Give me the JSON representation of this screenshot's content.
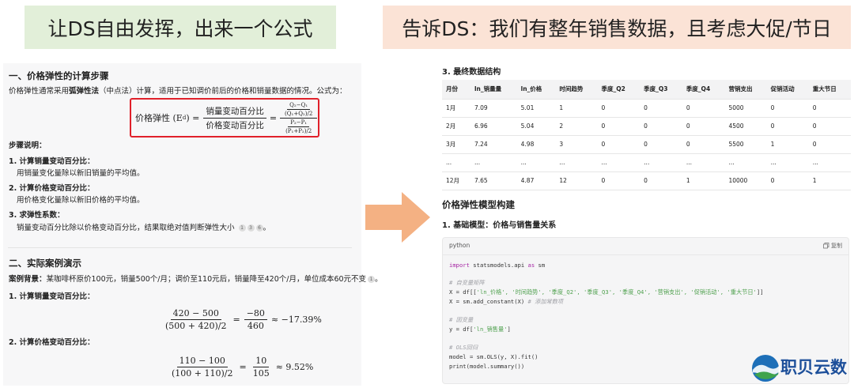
{
  "banners": {
    "left": "让DS自由发挥，出来一个公式",
    "right": "告诉DS：我们有整年销售数据，且考虑大促/节日"
  },
  "left_panel": {
    "section1_title": "一、价格弹性的计算步骤",
    "intro_pre": "价格弹性通常采用",
    "intro_bold": "弧弹性法",
    "intro_post": "（中点法）计算，适用于已知调价前后的价格和销量数据的情况。公式为：",
    "formula": {
      "lhs": "价格弹性 (E",
      "lhs_sub": "d",
      "lhs_end": ") =",
      "num_text": "销量变动百分比",
      "den_text": "价格变动百分比",
      "eq": "=",
      "num_expr_top": "Q₂−Q₁",
      "num_expr_bot": "(Q₁+Q₂)/2",
      "den_expr_top": "P₂−P₁",
      "den_expr_bot": "(P₁+P₂)/2"
    },
    "steps_title": "步骤说明：",
    "steps": [
      {
        "title": "1. 计算销量变动百分比：",
        "desc": "用销量变化量除以新旧销量的平均值。"
      },
      {
        "title": "2. 计算价格变动百分比：",
        "desc": "用价格变化量除以新旧价格的平均值。"
      },
      {
        "title": "3. 求弹性系数：",
        "desc": "销量变动百分比除以价格变动百分比，结果取绝对值判断弹性大小"
      }
    ],
    "step3_cites": [
      "1",
      "3",
      "6"
    ],
    "section2_title": "二、实际案例演示",
    "case_label": "案例背景：",
    "case_text": "某咖啡杯原价100元，销量500个/月；调价至110元后，销量降至420个/月，单位成本60元不变",
    "case_cite": "1",
    "calc1_title": "1. 计算销量变动百分比：",
    "calc1": {
      "n1": "420 − 500",
      "d1": "(500 + 420)/2",
      "n2": "−80",
      "d2": "460",
      "result": "≈ −17.39%"
    },
    "calc2_title": "2. 计算价格变动百分比：",
    "calc2": {
      "n1": "110 − 100",
      "d1": "(100 + 110)/2",
      "n2": "10",
      "d2": "105",
      "result": "≈ 9.52%"
    }
  },
  "right_panel": {
    "section3_title": "3. 最终数据结构",
    "table": {
      "headers": [
        "月份",
        "ln_销量量",
        "ln_价格",
        "时间趋势",
        "季度_Q2",
        "季度_Q3",
        "季度_Q4",
        "营销支出",
        "促销活动",
        "重大节日"
      ],
      "rows": [
        [
          "1月",
          "7.09",
          "5.01",
          "1",
          "0",
          "0",
          "0",
          "5000",
          "0",
          "0"
        ],
        [
          "2月",
          "6.96",
          "5.04",
          "2",
          "0",
          "0",
          "0",
          "4500",
          "0",
          "0"
        ],
        [
          "3月",
          "7.24",
          "4.98",
          "3",
          "0",
          "0",
          "0",
          "5500",
          "1",
          "0"
        ],
        [
          "...",
          "...",
          "...",
          "...",
          "...",
          "...",
          "...",
          "...",
          "...",
          "..."
        ],
        [
          "12月",
          "7.65",
          "4.87",
          "12",
          "0",
          "0",
          "1",
          "10000",
          "0",
          "1"
        ]
      ]
    },
    "model_title": "价格弹性模型构建",
    "basic_model_title": "1. 基础模型：价格与销售量关系",
    "code": {
      "lang": "python",
      "copy": "复制",
      "l1_kw": "import",
      "l1_rest": " statsmodels.api ",
      "l1_kw2": "as",
      "l1_end": " sm",
      "c1": "# 自变量矩阵",
      "l2_pre": "X = df[[",
      "l2_str": "'ln_价格', '时间趋势', '季度_Q2', '季度_Q3', '季度_Q4', '营销支出', '促销活动', '重大节日'",
      "l2_post": "]]",
      "l3": "X = sm.add_constant(X)  ",
      "l3_cm": "# 添加常数项",
      "c2": "# 因变量",
      "l4_pre": "y = df[",
      "l4_str": "'ln_销售量'",
      "l4_post": "]",
      "c3": "# OLS回归",
      "l5": "model = sm.OLS(y, X).fit()",
      "l6": "print(model.summary())"
    }
  },
  "logo": {
    "text": "职贝云数",
    "color": "#1d4f9a"
  },
  "colors": {
    "accent_red": "#e0202a",
    "arrow": "#f4b183",
    "banner_green": "#e2efd9",
    "banner_peach": "#fbe3d6"
  }
}
